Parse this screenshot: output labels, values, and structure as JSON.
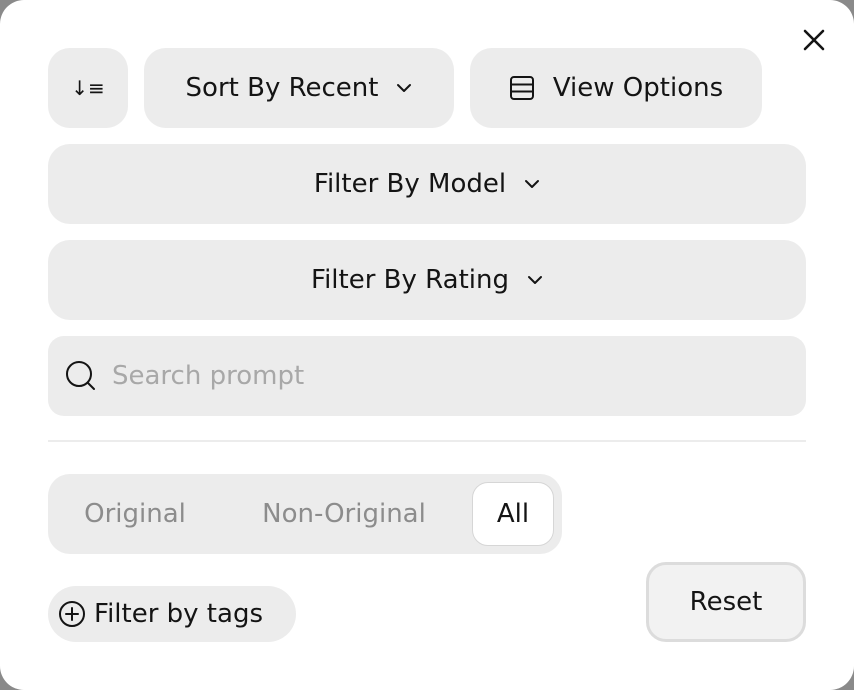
{
  "dialog": {
    "close_icon": "close-icon"
  },
  "toolbar": {
    "order_icon": "sort-order-icon",
    "order_glyph": "↓≡",
    "sort_label": "Sort By Recent",
    "view_label": "View Options",
    "view_icon": "layout-icon"
  },
  "filters": {
    "model_label": "Filter By Model",
    "rating_label": "Filter By Rating"
  },
  "search": {
    "placeholder": "Search prompt",
    "value": ""
  },
  "segmented": {
    "options": [
      "Original",
      "Non-Original",
      "All"
    ],
    "selected": "All"
  },
  "tags": {
    "label": "Filter by tags",
    "icon": "plus-circle-icon"
  },
  "actions": {
    "reset_label": "Reset"
  },
  "colors": {
    "surface": "#ececec",
    "text": "#141414",
    "muted": "#8c8c8c"
  }
}
